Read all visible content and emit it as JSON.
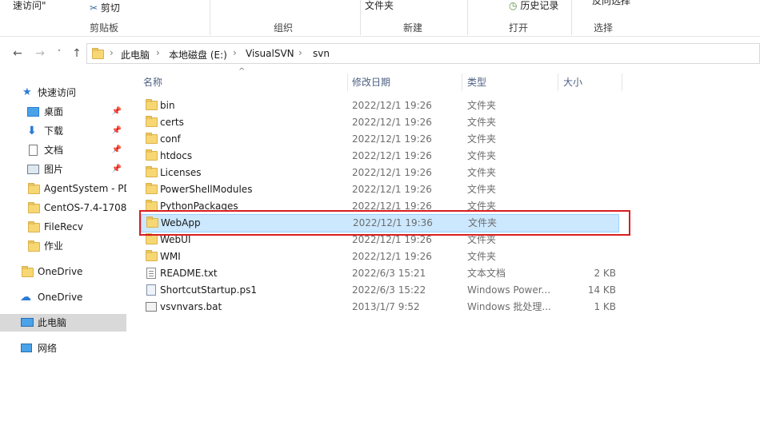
{
  "ribbon": {
    "items": {
      "quick_access": "速访问\"",
      "cut": "剪切",
      "folder": "文件夹",
      "history": "历史记录",
      "select": "反向选择"
    },
    "groups": {
      "clipboard": "剪贴板",
      "organize": "组织",
      "new": "新建",
      "open": "打开",
      "select": "选择"
    }
  },
  "address": {
    "crumbs": [
      "此电脑",
      "本地磁盘 (E:)",
      "VisualSVN",
      "svn"
    ],
    "separator": "›"
  },
  "nav": {
    "quick_access": "快速访问",
    "desktop": "桌面",
    "downloads": "下载",
    "documents": "文档",
    "pictures": "图片",
    "agent_system": "AgentSystem - PD",
    "centos": "CentOS-7.4-1708",
    "filerecv": "FileRecv",
    "homework": "作业",
    "onedrive1": "OneDrive",
    "onedrive2": "OneDrive",
    "this_pc": "此电脑",
    "network": "网络"
  },
  "columns": {
    "name": "名称",
    "modified": "修改日期",
    "type": "类型",
    "size": "大小"
  },
  "files": [
    {
      "name": "bin",
      "modified": "2022/12/1 19:26",
      "type": "文件夹",
      "size": ""
    },
    {
      "name": "certs",
      "modified": "2022/12/1 19:26",
      "type": "文件夹",
      "size": ""
    },
    {
      "name": "conf",
      "modified": "2022/12/1 19:26",
      "type": "文件夹",
      "size": ""
    },
    {
      "name": "htdocs",
      "modified": "2022/12/1 19:26",
      "type": "文件夹",
      "size": ""
    },
    {
      "name": "Licenses",
      "modified": "2022/12/1 19:26",
      "type": "文件夹",
      "size": ""
    },
    {
      "name": "PowerShellModules",
      "modified": "2022/12/1 19:26",
      "type": "文件夹",
      "size": ""
    },
    {
      "name": "PythonPackages",
      "modified": "2022/12/1 19:26",
      "type": "文件夹",
      "size": ""
    },
    {
      "name": "WebApp",
      "modified": "2022/12/1 19:36",
      "type": "文件夹",
      "size": ""
    },
    {
      "name": "WebUI",
      "modified": "2022/12/1 19:26",
      "type": "文件夹",
      "size": ""
    },
    {
      "name": "WMI",
      "modified": "2022/12/1 19:26",
      "type": "文件夹",
      "size": ""
    },
    {
      "name": "README.txt",
      "modified": "2022/6/3 15:21",
      "type": "文本文档",
      "size": "2 KB"
    },
    {
      "name": "ShortcutStartup.ps1",
      "modified": "2022/6/3 15:22",
      "type": "Windows Power...",
      "size": "14 KB"
    },
    {
      "name": "vsvnvars.bat",
      "modified": "2013/1/7 9:52",
      "type": "Windows 批处理...",
      "size": "1 KB"
    }
  ]
}
